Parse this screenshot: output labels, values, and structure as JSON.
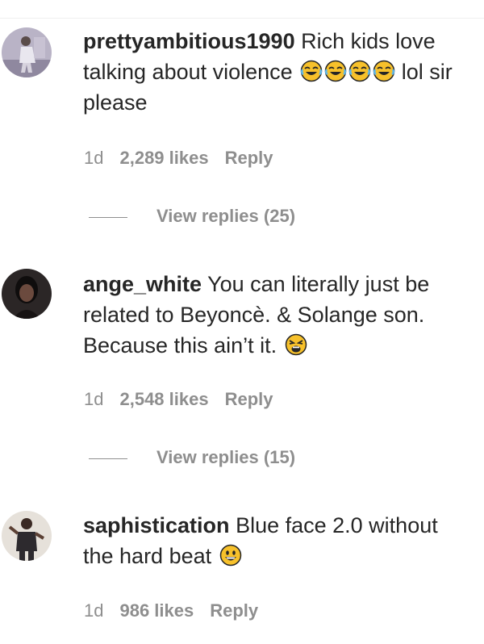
{
  "comments": [
    {
      "username": "prettyambitious1990",
      "text": "Rich kids love talking about violence",
      "text_after_emoji": "lol sir please",
      "emojis": [
        "face-with-tears-of-joy-icon",
        "face-with-tears-of-joy-icon",
        "face-with-tears-of-joy-icon",
        "face-with-tears-of-joy-icon"
      ],
      "time": "1d",
      "likes": "2,289 likes",
      "reply": "Reply",
      "view_replies": "View replies (25)"
    },
    {
      "username": "ange_white",
      "text": "You can literally just be related to Beyoncè. & Solange son. Because this ain’t it.",
      "emojis": [
        "weary-face-icon"
      ],
      "time": "1d",
      "likes": "2,548 likes",
      "reply": "Reply",
      "view_replies": "View replies (15)"
    },
    {
      "username": "saphistication",
      "text": "Blue face 2.0 without the hard beat",
      "emojis": [
        "grinning-face-icon"
      ],
      "time": "1d",
      "likes": "986 likes",
      "reply": "Reply"
    }
  ],
  "colors": {
    "text": "#262626",
    "secondary": "#8e8e8e",
    "emoji_yellow": "#f7c12b"
  }
}
